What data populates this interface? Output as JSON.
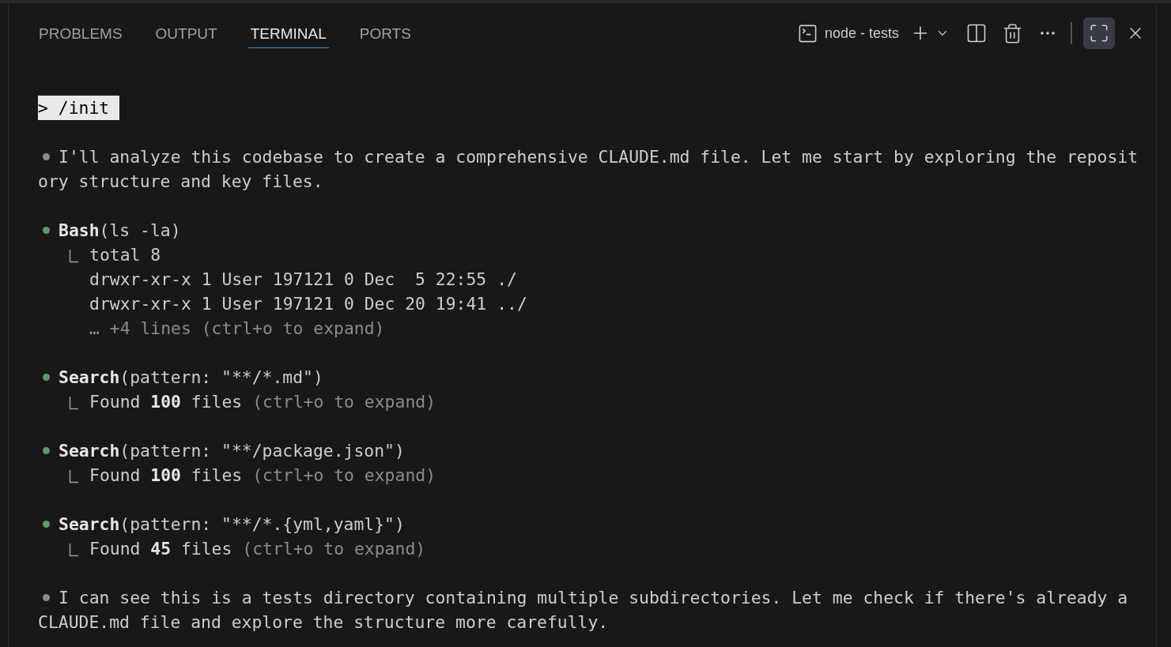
{
  "panel_tabs": [
    {
      "label": "PROBLEMS",
      "selected": false
    },
    {
      "label": "OUTPUT",
      "selected": false
    },
    {
      "label": "TERMINAL",
      "selected": true
    },
    {
      "label": "PORTS",
      "selected": false
    }
  ],
  "terminal_instance": {
    "label": "node - tests"
  },
  "maximize": {
    "selected": true
  },
  "terminal": {
    "prompt": "> /init",
    "entries": [
      {
        "kind": "message",
        "color": "#8c8c8c",
        "lines": [
          "I'll analyze this codebase to create a comprehensive CLAUDE.md file. Let me start by exploring the reposit",
          "ory structure and key files."
        ]
      },
      {
        "kind": "tool",
        "color": "#5a9a6e",
        "name": "Bash",
        "args": "(ls -la)",
        "output": [
          {
            "kind": "text",
            "text": "total 8"
          },
          {
            "kind": "text",
            "text": "drwxr-xr-x 1 User 197121 0 Dec  5 22:55 ./"
          },
          {
            "kind": "text",
            "text": "drwxr-xr-x 1 User 197121 0 Dec 20 19:41 ../"
          },
          {
            "kind": "more",
            "text": "… +4 lines (ctrl+o to expand)"
          }
        ]
      },
      {
        "kind": "tool",
        "color": "#5a9a6e",
        "name": "Search",
        "args": "(pattern: \"**/*.md\")",
        "output": [
          {
            "kind": "text",
            "text": "Found **100** files",
            "hint": "(ctrl+o to expand)"
          }
        ]
      },
      {
        "kind": "tool",
        "color": "#5a9a6e",
        "name": "Search",
        "args": "(pattern: \"**/package.json\")",
        "output": [
          {
            "kind": "text",
            "text": "Found **100** files",
            "hint": "(ctrl+o to expand)"
          }
        ]
      },
      {
        "kind": "tool",
        "color": "#5a9a6e",
        "name": "Search",
        "args": "(pattern: \"**/*.{yml,yaml}\")",
        "output": [
          {
            "kind": "text",
            "text": "Found **45** files",
            "hint": "(ctrl+o to expand)"
          }
        ]
      },
      {
        "kind": "message",
        "color": "#8c8c8c",
        "lines": [
          "I can see this is a tests directory containing multiple subdirectories. Let me check if there's already a",
          "CLAUDE.md file and explore the structure more carefully."
        ]
      }
    ]
  }
}
